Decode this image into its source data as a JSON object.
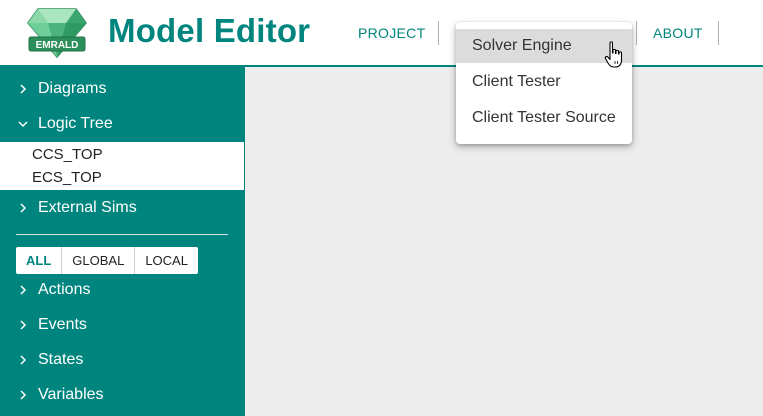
{
  "app": {
    "title": "Model Editor",
    "logo_text": "EMRALD",
    "brand_color": "#00857e"
  },
  "nav": {
    "project": "PROJECT",
    "about": "ABOUT"
  },
  "dropdown": {
    "items": [
      {
        "label": "Solver Engine",
        "hovered": true
      },
      {
        "label": "Client Tester",
        "hovered": false
      },
      {
        "label": "Client Tester Source",
        "hovered": false
      }
    ]
  },
  "sidebar": {
    "sections": {
      "diagrams": "Diagrams",
      "logic_tree": "Logic Tree",
      "external_sims": "External Sims",
      "actions": "Actions",
      "events": "Events",
      "states": "States",
      "variables": "Variables"
    },
    "logic_tree_items": [
      "CCS_TOP",
      "ECS_TOP"
    ],
    "filters": [
      {
        "label": "ALL",
        "active": true
      },
      {
        "label": "GLOBAL",
        "active": false
      },
      {
        "label": "LOCAL",
        "active": false
      }
    ]
  },
  "icons": {
    "logo": "emerald-gem-icon",
    "collapsed": "chevron-right-icon",
    "expanded": "chevron-down-icon",
    "cursor": "hand-pointer-icon"
  }
}
